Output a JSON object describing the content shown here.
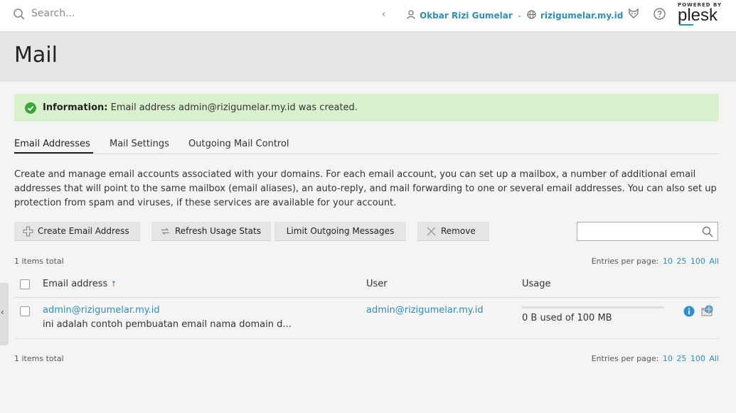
{
  "topbar": {
    "search_placeholder": "Search...",
    "user_name": "Okbar Rizi Gumelar",
    "domain": "rizigumelar.my.id",
    "icons": [
      "search-icon",
      "chevron-left-icon",
      "user-icon",
      "globe-icon",
      "fox-icon",
      "help-icon"
    ],
    "logo": {
      "powered_by": "POWERED BY",
      "brand": "plesk"
    }
  },
  "page": {
    "title": "Mail"
  },
  "info": {
    "label": "Information:",
    "message": "Email address admin@rizigumelar.my.id was created."
  },
  "tabs": [
    "Email Addresses",
    "Mail Settings",
    "Outgoing Mail Control"
  ],
  "active_tab": "Email Addresses",
  "description": "Create and manage email accounts associated with your domains. For each email account, you can set up a mailbox, a number of additional email addresses that will point to the same mailbox (email aliases), an auto-reply, and mail forwarding to one or several email addresses. You can also set up protection from spam and viruses, if these services are available for your account.",
  "toolbar": {
    "create": "Create Email Address",
    "refresh": "Refresh Usage Stats",
    "limit": "Limit Outgoing Messages",
    "remove": "Remove"
  },
  "list": {
    "items_total": "1 items total",
    "entries_label": "Entries per page:",
    "page_sizes": [
      "10",
      "25",
      "100",
      "All"
    ],
    "columns": {
      "email": "Email address",
      "user": "User",
      "usage": "Usage"
    },
    "rows": [
      {
        "email": "admin@rizigumelar.my.id",
        "description": "ini adalah contoh pembuatan email nama domain d...",
        "user": "admin@rizigumelar.my.id",
        "usage": "0 B used of 100 MB",
        "usage_fraction": 0
      }
    ]
  },
  "colors": {
    "accent": "#2d8fb6",
    "success_bg": "#d9f2cd",
    "success_icon": "#3aa635"
  }
}
